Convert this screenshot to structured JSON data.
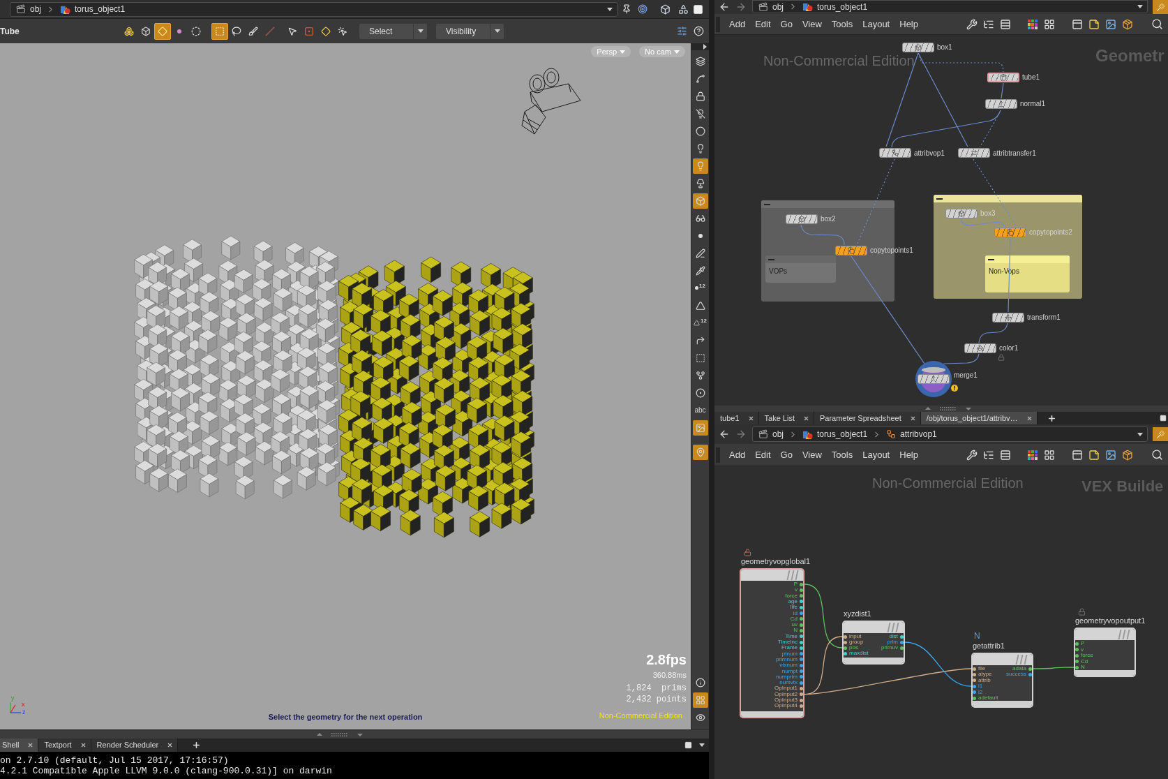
{
  "viewer": {
    "path": [
      "obj",
      "torus_object1"
    ],
    "tool_title": "Tube",
    "tools": [
      {
        "selected": false
      },
      {
        "selected": false
      },
      {
        "selected": true
      },
      {
        "selected": false
      },
      {
        "selected": false
      },
      {
        "selected": true
      },
      {
        "selected": false
      },
      {
        "selected": false
      },
      {
        "selected": false
      },
      {
        "selected": false
      },
      {
        "selected": false
      },
      {
        "selected": false
      },
      {
        "selected": false
      }
    ],
    "dropdowns": [
      "Select",
      "Visibility"
    ],
    "view_buttons": [
      "Persp",
      "No cam"
    ],
    "axis_labels": [
      "y",
      "x",
      "z"
    ],
    "prompt": "Select the geometry for the next operation",
    "fps": "2.8fps",
    "frame_time": "360.88ms",
    "stats": [
      "1,824  prims",
      "2,432 points"
    ],
    "edition": "Non-Commercial Edition",
    "side_tools": [
      {
        "selected": false
      },
      {
        "selected": false
      },
      {
        "selected": false
      },
      {
        "selected": false
      },
      {
        "selected": false
      },
      {
        "selected": false
      },
      {
        "selected": true
      },
      {
        "selected": false
      },
      {
        "selected": true
      },
      {
        "selected": false
      },
      {
        "selected": false
      },
      {
        "selected": false
      },
      {
        "selected": false
      },
      {
        "label": "12",
        "selected": false
      },
      {
        "selected": false
      },
      {
        "label": "12",
        "selected": false
      },
      {
        "selected": false
      },
      {
        "selected": false
      },
      {
        "selected": false
      },
      {
        "selected": false
      },
      {
        "label": "abc",
        "selected": false
      },
      {
        "selected": true
      },
      {
        "selected": true
      }
    ],
    "side_tools_bottom": [
      {
        "selected": false
      },
      {
        "selected": true
      },
      {
        "selected": false
      }
    ]
  },
  "console": {
    "tabs": [
      {
        "label": "Shell",
        "selected": true
      },
      {
        "label": "Textport",
        "selected": false
      },
      {
        "label": "Render Scheduler",
        "selected": false
      }
    ],
    "lines": [
      "on 2.7.10 (default, Jul 15 2017, 17:16:57)",
      "4.2.1 Compatible Apple LLVM 9.0.0 (clang-900.0.31)] on darwin"
    ]
  },
  "network": {
    "path": [
      "obj",
      "torus_object1"
    ],
    "menu": [
      "Add",
      "Edit",
      "Go",
      "View",
      "Tools",
      "Layout",
      "Help"
    ],
    "watermark": "Non-Commercial Edition",
    "context": "Geometr",
    "boxes": [
      {
        "color": "#5e5e5e"
      },
      {
        "label": "VOPs",
        "color": "#747474"
      },
      {
        "color": "#9b956b"
      },
      {
        "label": "Non-Vops",
        "color": "#e6de84"
      }
    ],
    "nodes": [
      {
        "name": "box1",
        "color": "#d2d2d2",
        "template": false,
        "display": false,
        "locked": false,
        "warning": false
      },
      {
        "name": "tube1",
        "color": "#d2d2d2",
        "template": true,
        "display": false,
        "locked": false,
        "warning": false
      },
      {
        "name": "normal1",
        "color": "#d2d2d2",
        "template": false,
        "display": false,
        "locked": false,
        "warning": false
      },
      {
        "name": "attribvop1",
        "color": "#d2d2d2",
        "template": false,
        "display": false,
        "locked": false,
        "warning": false
      },
      {
        "name": "attribtransfer1",
        "color": "#d2d2d2",
        "template": false,
        "display": false,
        "locked": false,
        "warning": false
      },
      {
        "name": "box2",
        "color": "#d2d2d2",
        "template": false,
        "display": false,
        "locked": false,
        "warning": false
      },
      {
        "name": "copytopoints1",
        "color": "#f5a01a",
        "template": false,
        "display": false,
        "locked": false,
        "warning": false
      },
      {
        "name": "box3",
        "color": "#d2d2d2",
        "template": false,
        "display": false,
        "locked": false,
        "warning": false
      },
      {
        "name": "copytopoints2",
        "color": "#f5a01a",
        "template": false,
        "display": false,
        "locked": false,
        "warning": false
      },
      {
        "name": "transform1",
        "color": "#d2d2d2",
        "template": false,
        "display": false,
        "locked": false,
        "warning": false
      },
      {
        "name": "color1",
        "color": "#d2d2d2",
        "template": false,
        "display": false,
        "locked": true,
        "warning": false
      },
      {
        "name": "merge1",
        "color": "#d2d2d2",
        "template": false,
        "display": true,
        "locked": false,
        "warning": true
      }
    ]
  },
  "vex": {
    "tabs": [
      {
        "label": "tube1",
        "selected": false
      },
      {
        "label": "Take List",
        "selected": false
      },
      {
        "label": "Parameter Spreadsheet",
        "selected": false
      },
      {
        "label": "/obj/torus_object1/attribv…",
        "selected": true
      }
    ],
    "path": [
      "obj",
      "torus_object1",
      "attribvop1"
    ],
    "menu": [
      "Add",
      "Edit",
      "Go",
      "View",
      "Tools",
      "Layout",
      "Help"
    ],
    "watermark": "Non-Commercial Edition",
    "context": "VEX Builde",
    "nodes": [
      {
        "name": "geometryvopglobal1",
        "template": true,
        "locked": false,
        "unlocked": true,
        "outputs": [
          {
            "name": "P",
            "color": "#5ec25e"
          },
          {
            "name": "v",
            "color": "#5ec25e"
          },
          {
            "name": "force",
            "color": "#5ec25e"
          },
          {
            "name": "age",
            "color": "#45cfcf"
          },
          {
            "name": "life",
            "color": "#45cfcf"
          },
          {
            "name": "id",
            "color": "#3aa6ee"
          },
          {
            "name": "Cd",
            "color": "#5ec25e"
          },
          {
            "name": "uv",
            "color": "#5ec25e"
          },
          {
            "name": "N",
            "color": "#5ec25e"
          },
          {
            "name": "Time",
            "color": "#45cfcf"
          },
          {
            "name": "TimeInc",
            "color": "#45cfcf"
          },
          {
            "name": "Frame",
            "color": "#45cfcf"
          },
          {
            "name": "ptnum",
            "color": "#3aa6ee"
          },
          {
            "name": "primnum",
            "color": "#3aa6ee"
          },
          {
            "name": "vtxnum",
            "color": "#3aa6ee"
          },
          {
            "name": "numpt",
            "color": "#3aa6ee"
          },
          {
            "name": "numprim",
            "color": "#3aa6ee"
          },
          {
            "name": "numvtx",
            "color": "#3aa6ee"
          },
          {
            "name": "OpInput1",
            "color": "#d1ad8b"
          },
          {
            "name": "OpInput2",
            "color": "#d1ad8b"
          },
          {
            "name": "OpInput3",
            "color": "#d1ad8b"
          },
          {
            "name": "OpInput4",
            "color": "#d1ad8b"
          }
        ]
      },
      {
        "name": "xyzdist1",
        "template": false,
        "locked": false,
        "unlocked": false,
        "inputs": [
          {
            "name": "input",
            "color": "#d1ad8b"
          },
          {
            "name": "group",
            "color": "#d1ad8b"
          },
          {
            "name": "pos",
            "color": "#5ec25e"
          },
          {
            "name": "maxdist",
            "color": "#45cfcf"
          }
        ],
        "outputs": [
          {
            "name": "dist",
            "color": "#45cfcf"
          },
          {
            "name": "prim",
            "color": "#3aa6ee"
          },
          {
            "name": "primuv",
            "color": "#5ec25e"
          }
        ]
      },
      {
        "name": "getattrib1",
        "template": false,
        "locked": false,
        "unlocked": false,
        "note": "N",
        "inputs": [
          {
            "name": "file",
            "color": "#d1ad8b"
          },
          {
            "name": "atype",
            "color": "#d1ad8b"
          },
          {
            "name": "attrib",
            "color": "#d1ad8b"
          },
          {
            "name": "i1",
            "color": "#3aa6ee"
          },
          {
            "name": "i2",
            "color": "#3aa6ee"
          },
          {
            "name": "adefault",
            "color": "#5ec25e"
          }
        ],
        "outputs": [
          {
            "name": "adata",
            "color": "#5ec25e"
          },
          {
            "name": "success",
            "color": "#3aa6ee"
          }
        ]
      },
      {
        "name": "geometryvopoutput1",
        "template": false,
        "locked": true,
        "unlocked": false,
        "inputs": [
          {
            "name": "P",
            "color": "#5ec25e"
          },
          {
            "name": "v",
            "color": "#5ec25e"
          },
          {
            "name": "force",
            "color": "#5ec25e"
          },
          {
            "name": "Cd",
            "color": "#5ec25e"
          },
          {
            "name": "N",
            "color": "#5ec25e"
          }
        ]
      }
    ]
  }
}
